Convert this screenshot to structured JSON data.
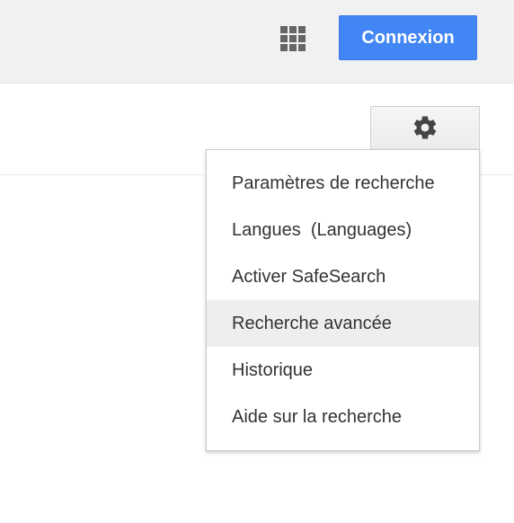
{
  "header": {
    "apps_icon": "apps-grid-icon",
    "signin_label": "Connexion",
    "signin_color": "#4285f4"
  },
  "settings": {
    "icon": "gear-icon"
  },
  "menu": {
    "items": [
      {
        "label": "Paramètres de recherche"
      },
      {
        "label": "Langues  (Languages)"
      },
      {
        "label": "Activer SafeSearch"
      },
      {
        "label": "Recherche avancée",
        "highlighted": true
      },
      {
        "label": "Historique"
      },
      {
        "label": "Aide sur la recherche"
      }
    ]
  }
}
